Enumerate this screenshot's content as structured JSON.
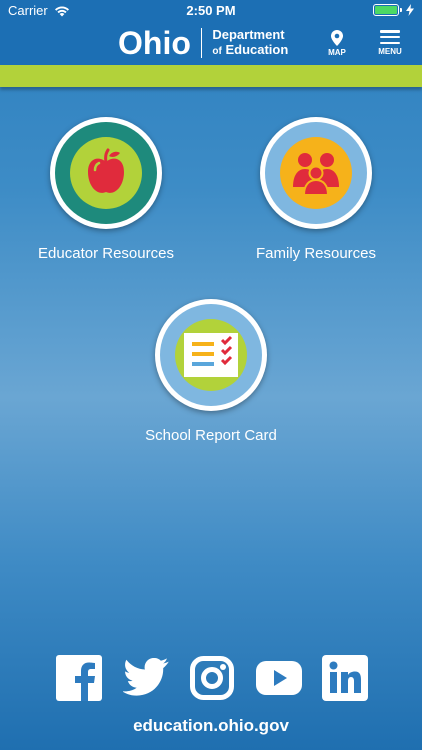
{
  "status_bar": {
    "carrier": "Carrier",
    "time": "2:50 PM",
    "battery_level": 1.0
  },
  "header": {
    "logo_text": "Ohio",
    "dept_line1": "Department",
    "dept_line2_prefix": "of",
    "dept_line2": "Education",
    "map_label": "MAP",
    "menu_label": "MENU"
  },
  "tiles": [
    {
      "label": "Educator Resources",
      "icon": "apple-icon"
    },
    {
      "label": "Family Resources",
      "icon": "family-icon"
    },
    {
      "label": "School Report Card",
      "icon": "report-card-icon"
    }
  ],
  "social": [
    "facebook-icon",
    "twitter-icon",
    "instagram-icon",
    "youtube-icon",
    "linkedin-icon"
  ],
  "footer": {
    "url": "education.ohio.gov"
  },
  "colors": {
    "header_blue": "#1c6fb4",
    "accent_green": "#b2d23a",
    "teal": "#1e8a7c",
    "light_blue": "#7fb7e0",
    "gold": "#f6b21a",
    "red": "#e02b3c"
  }
}
